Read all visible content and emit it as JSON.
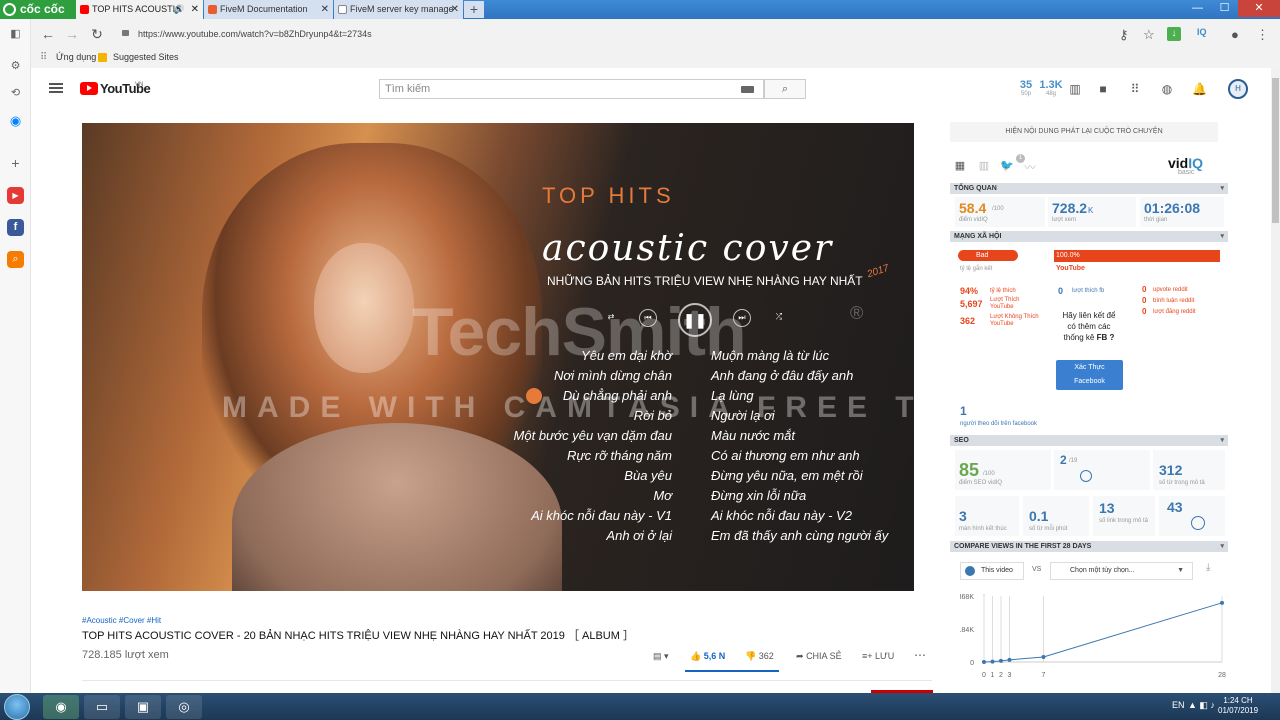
{
  "browser": {
    "logo_text": "cốc cốc",
    "tabs": [
      {
        "label": "TOP HITS ACOUSTIC",
        "active": true
      },
      {
        "label": "FiveM Documentation",
        "active": false
      },
      {
        "label": "FiveM server key manage",
        "active": false
      }
    ],
    "url": "https://www.youtube.com/watch?v=b8ZhDryunp4&t=2734s",
    "bookmarks": [
      "Ứng dụng",
      "Suggested Sites"
    ],
    "ext_label": "IQ"
  },
  "youtube": {
    "logo_text": "YouTube",
    "country": "VN",
    "search_placeholder": "Tìm kiếm",
    "header_stats": [
      {
        "value": "35",
        "label": "50p"
      },
      {
        "value": "1.3K",
        "label": "48g"
      }
    ],
    "avatar_initials": "H"
  },
  "video": {
    "heading": "TOP HITS",
    "script_title": "acoustic cover",
    "subtitle": "NHỮNG BẢN HITS TRIỆU VIEW NHẸ NHÀNG HAY NHẤT",
    "year": "2017",
    "watermark": "TechSmith",
    "watermark_mark": "®",
    "banner": "MADE WITH CAMTASIA FREE TRIAL",
    "tracklist_left": [
      "Yêu em dại khờ",
      "Nơi mình dừng chân",
      "Dù chẳng phải anh",
      "Rời bỏ",
      "Một bước yêu vạn dặm đau",
      "Rực rỡ tháng năm",
      "Bùa yêu",
      "Mơ",
      "Ai khóc nỗi đau này - V1",
      "Anh ơi ở lại"
    ],
    "tracklist_right": [
      "Muộn màng là từ lúc",
      "Anh đang ở đâu đấy anh",
      "Lạ lùng",
      "Người lạ ơi",
      "Màu nước mắt",
      "Có ai thương em như anh",
      "Đừng yêu nữa, em mệt rồi",
      "Đừng xin lỗi nữa",
      "Ai khóc nỗi đau này - V2",
      "Em đã thấy anh cùng người ấy"
    ],
    "hashtags": "#Acoustic #Cover #Hit",
    "title": "TOP HITS ACOUSTIC COVER - 20 BẢN NHẠC HITS TRIỆU VIEW NHẸ NHÀNG HAY NHẤT 2019 ［ ALBUM ］",
    "views": "728.185 lượt xem",
    "likes": "5,6 N",
    "dislikes": "362",
    "share_label": "CHIA SẺ",
    "save_label": "LƯU"
  },
  "vidiq": {
    "chat_label": "HIỆN NỘI DUNG PHÁT LẠI CUỘC TRÒ CHUYỆN",
    "logo_a": "vid",
    "logo_b": "IQ",
    "plan": "basic",
    "notif_count": "1",
    "overview": {
      "header": "TỔNG QUAN",
      "score": "58.4",
      "score_max": "/100",
      "score_label": "điểm vidIQ",
      "views": "728.2",
      "views_unit": "K",
      "views_label": "lượt xem",
      "duration": "01:26:08",
      "duration_label": "thời gian"
    },
    "social": {
      "header": "MẠNG XÃ HỘI",
      "engagement_badge": "Bad",
      "engagement_label": "tỷ lệ gắn kết",
      "youtube_pct": "100.0%",
      "youtube_label": "YouTube",
      "like_ratio": "94%",
      "like_ratio_label": "tỷ lệ thích",
      "yt_likes": "5,697",
      "yt_likes_label": "Lượt Thích YouTube",
      "yt_dislikes": "362",
      "yt_dislikes_label": "Lượt Không Thích YouTube",
      "fb_likes": "0",
      "fb_likes_label": "lượt thích fb",
      "reddit_upvotes": "0",
      "reddit_upvotes_label": "upvote reddit",
      "reddit_comments": "0",
      "reddit_comments_label": "bình luận reddit",
      "reddit_posts": "0",
      "reddit_posts_label": "lượt đăng reddit",
      "fb_prompt_1": "Hãy liên kết để",
      "fb_prompt_2": "có thêm các",
      "fb_prompt_3": "thống kê",
      "fb_prompt_bold": "FB ?",
      "fb_button_1": "Xác Thực",
      "fb_button_2": "Facebook",
      "fb_followers": "1",
      "fb_followers_label": "người theo dõi trên facebook"
    },
    "seo": {
      "header": "SEO",
      "score": "85",
      "score_max": "/100",
      "score_label": "điểm SEO vidIQ",
      "tags_in_title": "2",
      "tags_in_title_max": "/19",
      "desc_words": "312",
      "desc_words_label": "số từ trong mô tả",
      "endscreens": "3",
      "endscreens_label": "màn hình kết thúc",
      "words_per_min": "0.1",
      "words_per_min_label": "số từ mỗi phút",
      "desc_links": "13",
      "desc_links_label": "số link trong mô tả",
      "tag_count": "43"
    },
    "compare": {
      "header": "COMPARE VIEWS IN THE FIRST 28 DAYS",
      "this_video": "This video",
      "vs": "VS",
      "select_placeholder": "Chọn một tùy chọn..."
    }
  },
  "chart_data": {
    "type": "line",
    "x": [
      0,
      1,
      2,
      3,
      7,
      28
    ],
    "series": [
      {
        "values": [
          0,
          2000,
          6000,
          12000,
          28000,
          330000
        ]
      }
    ],
    "ytick_labels": [
      "368K",
      "184K",
      "0"
    ],
    "xtick_labels": [
      "0",
      "1",
      "2",
      "3",
      "7",
      "28"
    ],
    "ylim": [
      0,
      368000
    ],
    "xlim": [
      0,
      28
    ],
    "color": "#3c77b0"
  },
  "taskbar": {
    "time": "1:24 CH",
    "date": "01/07/2019",
    "lang": "EN"
  }
}
